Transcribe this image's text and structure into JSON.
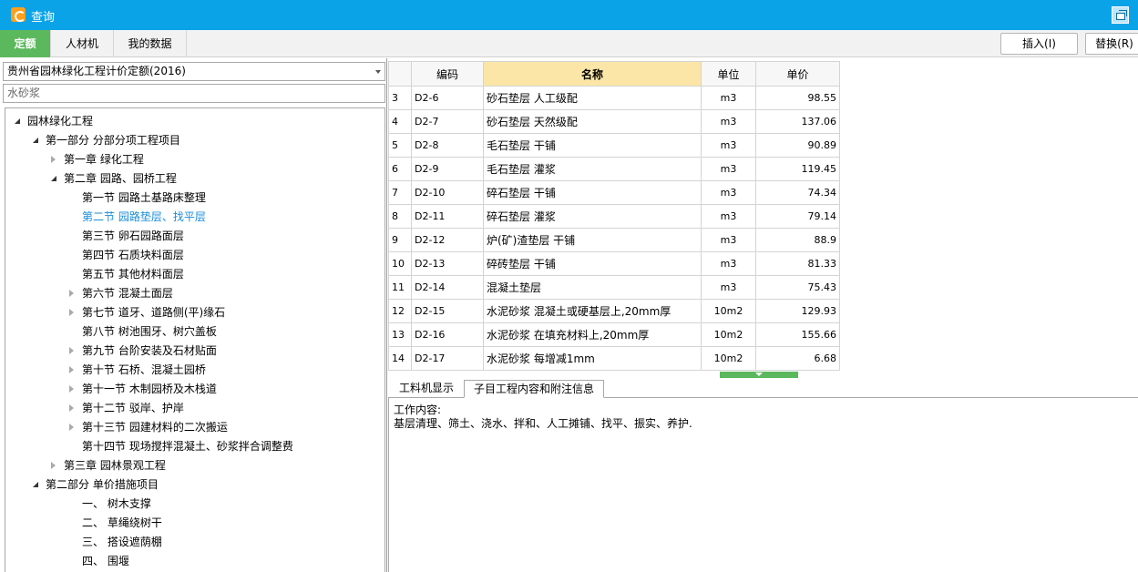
{
  "window": {
    "title": "查询"
  },
  "tabs": [
    "定额",
    "人材机",
    "我的数据"
  ],
  "actions": {
    "insert": "插入(I)",
    "replace": "替换(R)"
  },
  "left": {
    "dropdown_value": "贵州省园林绿化工程计价定额(2016)",
    "search_value": "水砂浆",
    "tree": [
      {
        "label": "园林绿化工程",
        "level": 0,
        "state": "expanded"
      },
      {
        "label": "第一部分 分部分项工程项目",
        "level": 1,
        "state": "expanded"
      },
      {
        "label": "第一章 绿化工程",
        "level": 2,
        "state": "collapsed"
      },
      {
        "label": "第二章 园路、园桥工程",
        "level": 2,
        "state": "expanded"
      },
      {
        "label": "第一节 园路土基路床整理",
        "level": 3,
        "state": "leaf"
      },
      {
        "label": "第二节 园路垫层、找平层",
        "level": 3,
        "state": "leaf",
        "selected": true
      },
      {
        "label": "第三节 卵石园路面层",
        "level": 3,
        "state": "leaf"
      },
      {
        "label": "第四节 石质块料面层",
        "level": 3,
        "state": "leaf"
      },
      {
        "label": "第五节 其他材料面层",
        "level": 3,
        "state": "leaf"
      },
      {
        "label": "第六节 混凝土面层",
        "level": 3,
        "state": "collapsed"
      },
      {
        "label": "第七节 道牙、道路侧(平)缘石",
        "level": 3,
        "state": "collapsed"
      },
      {
        "label": "第八节 树池围牙、树穴盖板",
        "level": 3,
        "state": "leaf"
      },
      {
        "label": "第九节 台阶安装及石材贴面",
        "level": 3,
        "state": "collapsed"
      },
      {
        "label": "第十节 石桥、混凝土园桥",
        "level": 3,
        "state": "collapsed"
      },
      {
        "label": "第十一节 木制园桥及木栈道",
        "level": 3,
        "state": "collapsed"
      },
      {
        "label": "第十二节 驳岸、护岸",
        "level": 3,
        "state": "collapsed"
      },
      {
        "label": "第十三节 园建材料的二次搬运",
        "level": 3,
        "state": "collapsed"
      },
      {
        "label": "第十四节 现场搅拌混凝土、砂浆拌合调整费",
        "level": 3,
        "state": "leaf"
      },
      {
        "label": "第三章 园林景观工程",
        "level": 2,
        "state": "collapsed"
      },
      {
        "label": "第二部分 单价措施项目",
        "level": 1,
        "state": "expanded"
      },
      {
        "label": "一、 树木支撑",
        "level": 3,
        "state": "leaf"
      },
      {
        "label": "二、 草绳绕树干",
        "level": 3,
        "state": "leaf"
      },
      {
        "label": "三、 搭设遮荫棚",
        "level": 3,
        "state": "leaf"
      },
      {
        "label": "四、 围堰",
        "level": 3,
        "state": "leaf"
      }
    ]
  },
  "grid": {
    "headers": [
      "",
      "编码",
      "名称",
      "单位",
      "单价"
    ],
    "rows": [
      {
        "no": "3",
        "code": "D2-6",
        "name": "砂石垫层 人工级配",
        "unit": "m3",
        "price": "98.55"
      },
      {
        "no": "4",
        "code": "D2-7",
        "name": "砂石垫层 天然级配",
        "unit": "m3",
        "price": "137.06"
      },
      {
        "no": "5",
        "code": "D2-8",
        "name": "毛石垫层 干铺",
        "unit": "m3",
        "price": "90.89"
      },
      {
        "no": "6",
        "code": "D2-9",
        "name": "毛石垫层 灌浆",
        "unit": "m3",
        "price": "119.45"
      },
      {
        "no": "7",
        "code": "D2-10",
        "name": "碎石垫层 干铺",
        "unit": "m3",
        "price": "74.34"
      },
      {
        "no": "8",
        "code": "D2-11",
        "name": "碎石垫层 灌浆",
        "unit": "m3",
        "price": "79.14"
      },
      {
        "no": "9",
        "code": "D2-12",
        "name": "炉(矿)渣垫层 干铺",
        "unit": "m3",
        "price": "88.9"
      },
      {
        "no": "10",
        "code": "D2-13",
        "name": "碎砖垫层 干铺",
        "unit": "m3",
        "price": "81.33"
      },
      {
        "no": "11",
        "code": "D2-14",
        "name": "混凝土垫层",
        "unit": "m3",
        "price": "75.43"
      },
      {
        "no": "12",
        "code": "D2-15",
        "name": "水泥砂浆 混凝土或硬基层上,20mm厚",
        "unit": "10m2",
        "price": "129.93"
      },
      {
        "no": "13",
        "code": "D2-16",
        "name": "水泥砂浆 在填充材料上,20mm厚",
        "unit": "10m2",
        "price": "155.66"
      },
      {
        "no": "14",
        "code": "D2-17",
        "name": "水泥砂浆 每增减1mm",
        "unit": "10m2",
        "price": "6.68"
      }
    ]
  },
  "bottom": {
    "tabs": [
      "工料机显示",
      "子目工程内容和附注信息"
    ],
    "content_title": "工作内容:",
    "content_body": "基层清理、筛土、浇水、拌和、人工摊铺、找平、振实、养护."
  },
  "colors": {
    "titlebar": "#0aa3e8",
    "active_tab": "#5cb85c",
    "selected_node": "#1a8cd8",
    "name_header": "#fbe6a8"
  }
}
